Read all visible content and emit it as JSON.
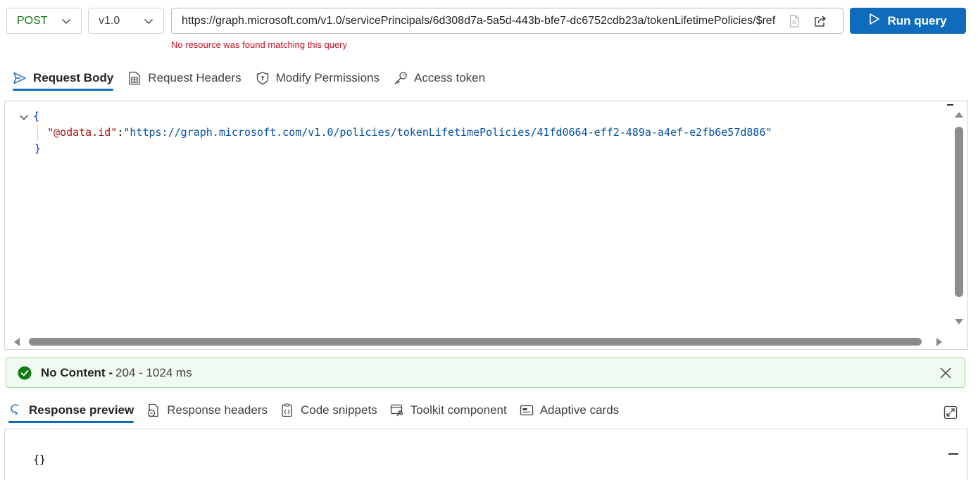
{
  "query_bar": {
    "method": "POST",
    "version": "v1.0",
    "url": "https://graph.microsoft.com/v1.0/servicePrincipals/6d308d7a-5a5d-443b-bfe7-dc6752cdb23a/tokenLifetimePolicies/$ref",
    "run_label": "Run query",
    "error": "No resource was found matching this query"
  },
  "request_tabs": [
    {
      "label": "Request Body",
      "icon": "send-icon",
      "active": true
    },
    {
      "label": "Request Headers",
      "icon": "document-table-icon",
      "active": false
    },
    {
      "label": "Modify Permissions",
      "icon": "shield-icon",
      "active": false
    },
    {
      "label": "Access token",
      "icon": "key-icon",
      "active": false
    }
  ],
  "request_body": {
    "open_brace": "{",
    "key": "\"@odata.id\"",
    "colon": ":",
    "value": "\"https://graph.microsoft.com/v1.0/policies/tokenLifetimePolicies/41fd0664-eff2-489a-a4ef-e2fb6e57d886\"",
    "close_brace": "}"
  },
  "status": {
    "title": "No Content -",
    "detail": "204 - 1024 ms",
    "color": "#107c10"
  },
  "response_tabs": [
    {
      "label": "Response preview",
      "icon": "response-preview-icon",
      "active": true
    },
    {
      "label": "Response headers",
      "icon": "document-headers-icon",
      "active": false
    },
    {
      "label": "Code snippets",
      "icon": "code-snippet-icon",
      "active": false
    },
    {
      "label": "Toolkit component",
      "icon": "toolkit-icon",
      "active": false
    },
    {
      "label": "Adaptive cards",
      "icon": "adaptive-card-icon",
      "active": false
    }
  ],
  "response_body": "{}",
  "colors": {
    "accent": "#0f6cbd",
    "error": "#c50f1f",
    "method": "#107c10",
    "status_bg": "#f1faf1"
  }
}
